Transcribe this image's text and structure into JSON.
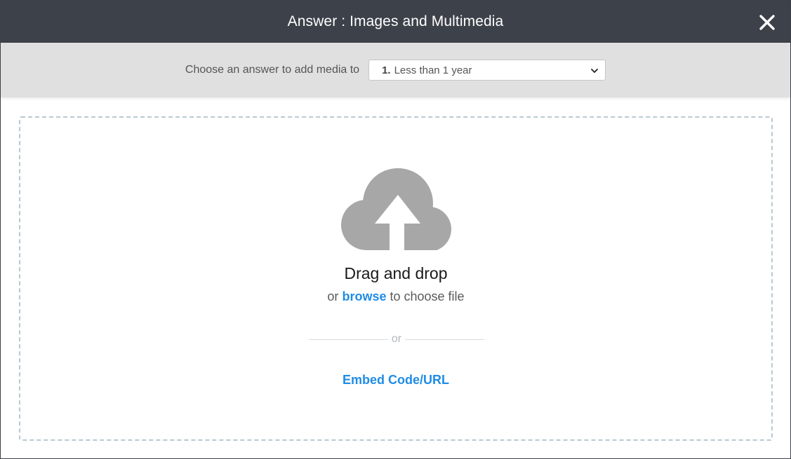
{
  "header": {
    "title": "Answer : Images and Multimedia",
    "close_icon": "close-icon"
  },
  "toolbar": {
    "label": "Choose an answer to add media to",
    "select": {
      "number": "1.",
      "selected": "Less than 1 year",
      "icon": "chevron-down-icon"
    }
  },
  "dropzone": {
    "icon": "cloud-upload-icon",
    "title": "Drag and drop",
    "browse_prefix": "or",
    "browse_link": "browse",
    "browse_suffix": "to choose file",
    "or_text": "or",
    "embed_link": "Embed Code/URL"
  },
  "colors": {
    "header_bg": "#3d4149",
    "toolbar_bg": "#e0e0e0",
    "link": "#1f8ce6",
    "icon_gray": "#a7a7a7",
    "dash_border": "#b9c9d1"
  }
}
